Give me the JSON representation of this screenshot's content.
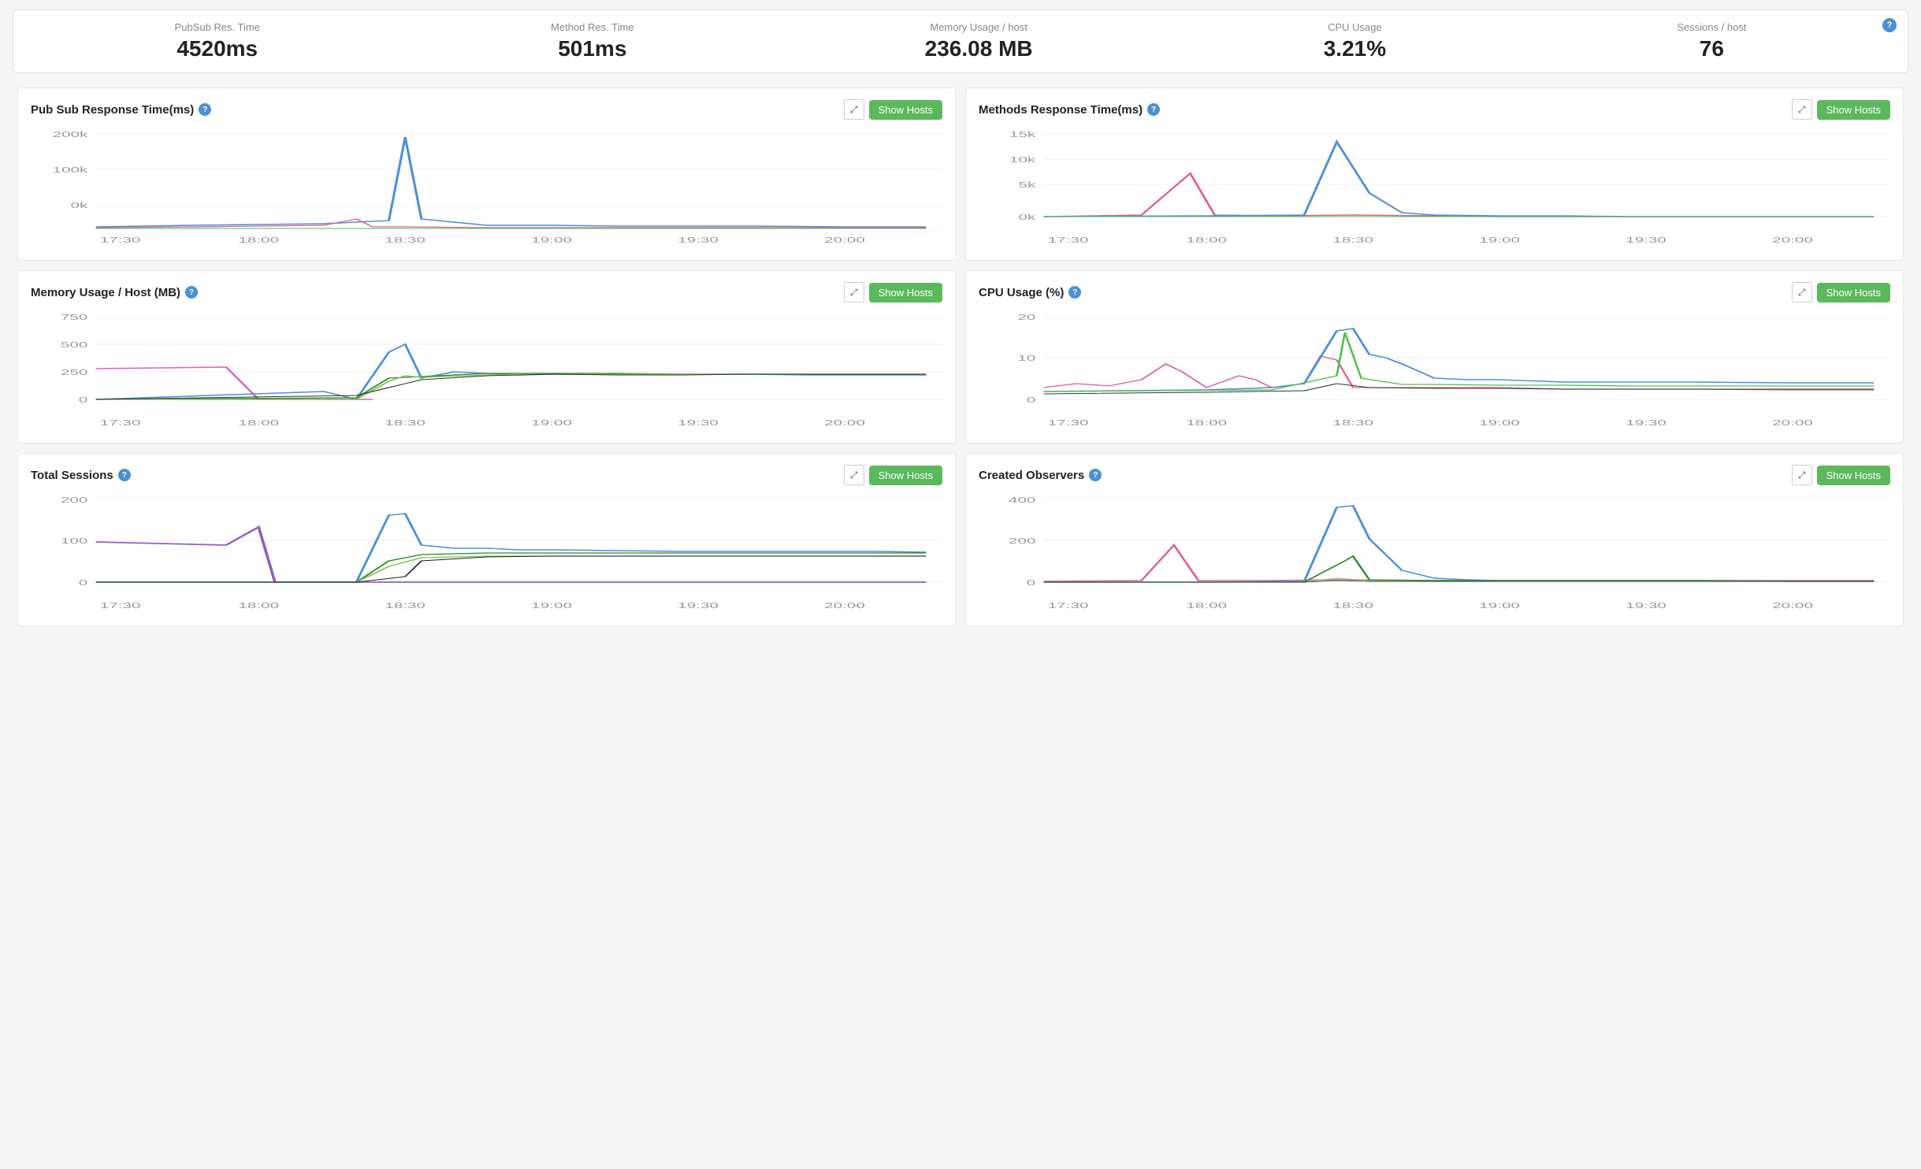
{
  "stats": {
    "help_icon": "?",
    "items": [
      {
        "label": "PubSub Res. Time",
        "value": "4520ms"
      },
      {
        "label": "Method Res. Time",
        "value": "501ms"
      },
      {
        "label": "Memory Usage / host",
        "value": "236.08 MB"
      },
      {
        "label": "CPU Usage",
        "value": "3.21%"
      },
      {
        "label": "Sessions / host",
        "value": "76"
      }
    ]
  },
  "charts": [
    {
      "id": "pubsub",
      "title": "Pub Sub Response Time(ms)",
      "position": "top-left",
      "show_hosts_label": "Show Hosts",
      "expand_icon": "⤢",
      "y_labels": [
        "200k",
        "100k",
        "0k"
      ],
      "x_labels": [
        "17:30",
        "18:00",
        "18:30",
        "19:00",
        "19:30",
        "20:00"
      ]
    },
    {
      "id": "methods",
      "title": "Methods Response Time(ms)",
      "position": "top-right",
      "show_hosts_label": "Show Hosts",
      "expand_icon": "⤢",
      "y_labels": [
        "15k",
        "10k",
        "5k",
        "0k"
      ],
      "x_labels": [
        "17:30",
        "18:00",
        "18:30",
        "19:00",
        "19:30",
        "20:00"
      ]
    },
    {
      "id": "memory",
      "title": "Memory Usage / Host (MB)",
      "position": "mid-left",
      "show_hosts_label": "Show Hosts",
      "expand_icon": "⤢",
      "y_labels": [
        "750",
        "500",
        "250",
        "0"
      ],
      "x_labels": [
        "17:30",
        "18:00",
        "18:30",
        "19:00",
        "19:30",
        "20:00"
      ]
    },
    {
      "id": "cpu",
      "title": "CPU Usage (%)",
      "position": "mid-right",
      "show_hosts_label": "Show Hosts",
      "expand_icon": "⤢",
      "y_labels": [
        "20",
        "10",
        "0"
      ],
      "x_labels": [
        "17:30",
        "18:00",
        "18:30",
        "19:00",
        "19:30",
        "20:00"
      ]
    },
    {
      "id": "sessions",
      "title": "Total Sessions",
      "position": "bot-left",
      "show_hosts_label": "Show Hosts",
      "expand_icon": "⤢",
      "y_labels": [
        "200",
        "100",
        "0"
      ],
      "x_labels": [
        "17:30",
        "18:00",
        "18:30",
        "19:00",
        "19:30",
        "20:00"
      ]
    },
    {
      "id": "observers",
      "title": "Created Observers",
      "position": "bot-right",
      "show_hosts_label": "Show Hosts",
      "expand_icon": "⤢",
      "y_labels": [
        "400",
        "200",
        "0"
      ],
      "x_labels": [
        "17:30",
        "18:00",
        "18:30",
        "19:00",
        "19:30",
        "20:00"
      ]
    }
  ]
}
